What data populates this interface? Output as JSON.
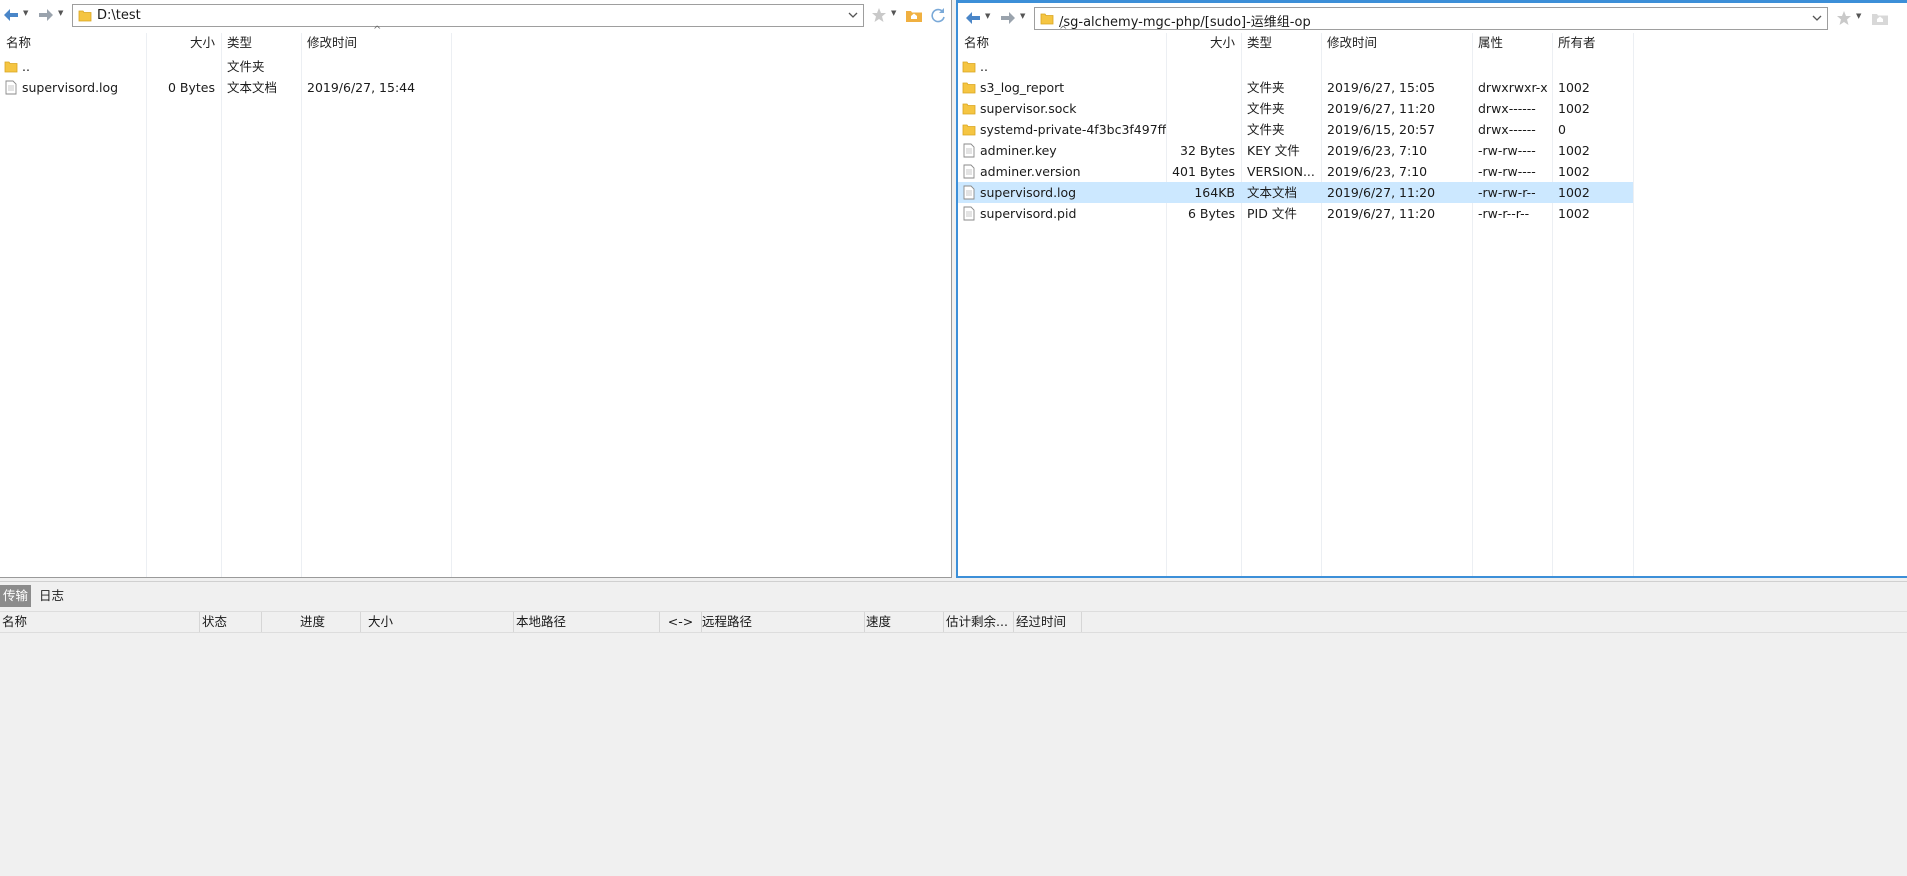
{
  "left": {
    "path": "D:\\test",
    "columns": [
      "名称",
      "大小",
      "类型",
      "修改时间"
    ],
    "files": [
      {
        "name": "..",
        "size": "",
        "type": "文件夹",
        "modified": "",
        "icon": "folder-icon"
      },
      {
        "name": "supervisord.log",
        "size": "0 Bytes",
        "type": "文本文档",
        "modified": "2019/6/27, 15:44",
        "icon": "file-icon"
      }
    ]
  },
  "right": {
    "path": "/sg-alchemy-mgc-php/[sudo]-运维组-op",
    "columns": [
      "名称",
      "大小",
      "类型",
      "修改时间",
      "属性",
      "所有者"
    ],
    "files": [
      {
        "name": "..",
        "size": "",
        "type": "",
        "modified": "",
        "attrs": "",
        "owner": "",
        "icon": "folder-icon"
      },
      {
        "name": "s3_log_report",
        "size": "",
        "type": "文件夹",
        "modified": "2019/6/27, 15:05",
        "attrs": "drwxrwxr-x",
        "owner": "1002",
        "icon": "folder-icon"
      },
      {
        "name": "supervisor.sock",
        "size": "",
        "type": "文件夹",
        "modified": "2019/6/27, 11:20",
        "attrs": "drwx------",
        "owner": "1002",
        "icon": "folder-icon"
      },
      {
        "name": "systemd-private-4f3bc3f497ff...",
        "size": "",
        "type": "文件夹",
        "modified": "2019/6/15, 20:57",
        "attrs": "drwx------",
        "owner": "0",
        "icon": "folder-icon"
      },
      {
        "name": "adminer.key",
        "size": "32 Bytes",
        "type": "KEY 文件",
        "modified": "2019/6/23, 7:10",
        "attrs": "-rw-rw----",
        "owner": "1002",
        "icon": "file-icon"
      },
      {
        "name": "adminer.version",
        "size": "401 Bytes",
        "type": "VERSION...",
        "modified": "2019/6/23, 7:10",
        "attrs": "-rw-rw----",
        "owner": "1002",
        "icon": "file-icon"
      },
      {
        "name": "supervisord.log",
        "size": "164KB",
        "type": "文本文档",
        "modified": "2019/6/27, 11:20",
        "attrs": "-rw-rw-r--",
        "owner": "1002",
        "icon": "file-icon",
        "selected": true
      },
      {
        "name": "supervisord.pid",
        "size": "6 Bytes",
        "type": "PID 文件",
        "modified": "2019/6/27, 11:20",
        "attrs": "-rw-r--r--",
        "owner": "1002",
        "icon": "file-icon"
      }
    ]
  },
  "bottom": {
    "tabs": [
      "传输",
      "日志"
    ],
    "active_tab": "传输",
    "columns": [
      "名称",
      "状态",
      "进度",
      "大小",
      "本地路径",
      "<->",
      "远程路径",
      "速度",
      "估计剩余...",
      "经过时间"
    ]
  },
  "colors": {
    "selection": "#cce8ff",
    "active_border": "#3c8fd8",
    "folder": "#f5c542",
    "nav_arrow": "#4a86c8"
  }
}
